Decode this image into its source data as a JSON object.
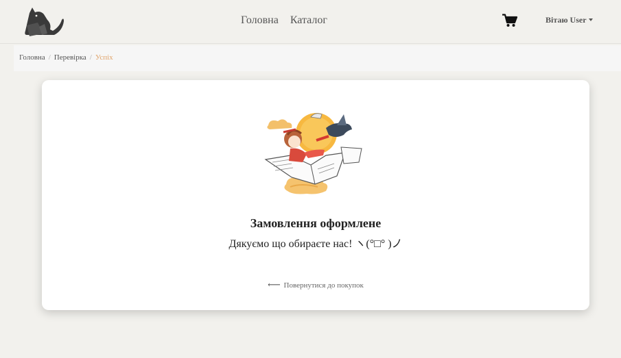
{
  "navbar": {
    "links": [
      "Головна",
      "Каталог"
    ],
    "user_greeting": "Вітаю User"
  },
  "breadcrumb": {
    "items": [
      "Головна",
      "Перевірка"
    ],
    "active": "Успіх",
    "separator": "/"
  },
  "success": {
    "title": "Замовлення оформлене",
    "message": "Дякуємо що обираєте нас! ヽ(°□° )ノ",
    "back_arrow": "⟵",
    "back_label": "Повернутися до покупок"
  },
  "colors": {
    "background": "#f2f1ed",
    "active_breadcrumb": "#e0a36a",
    "card": "#ffffff"
  }
}
